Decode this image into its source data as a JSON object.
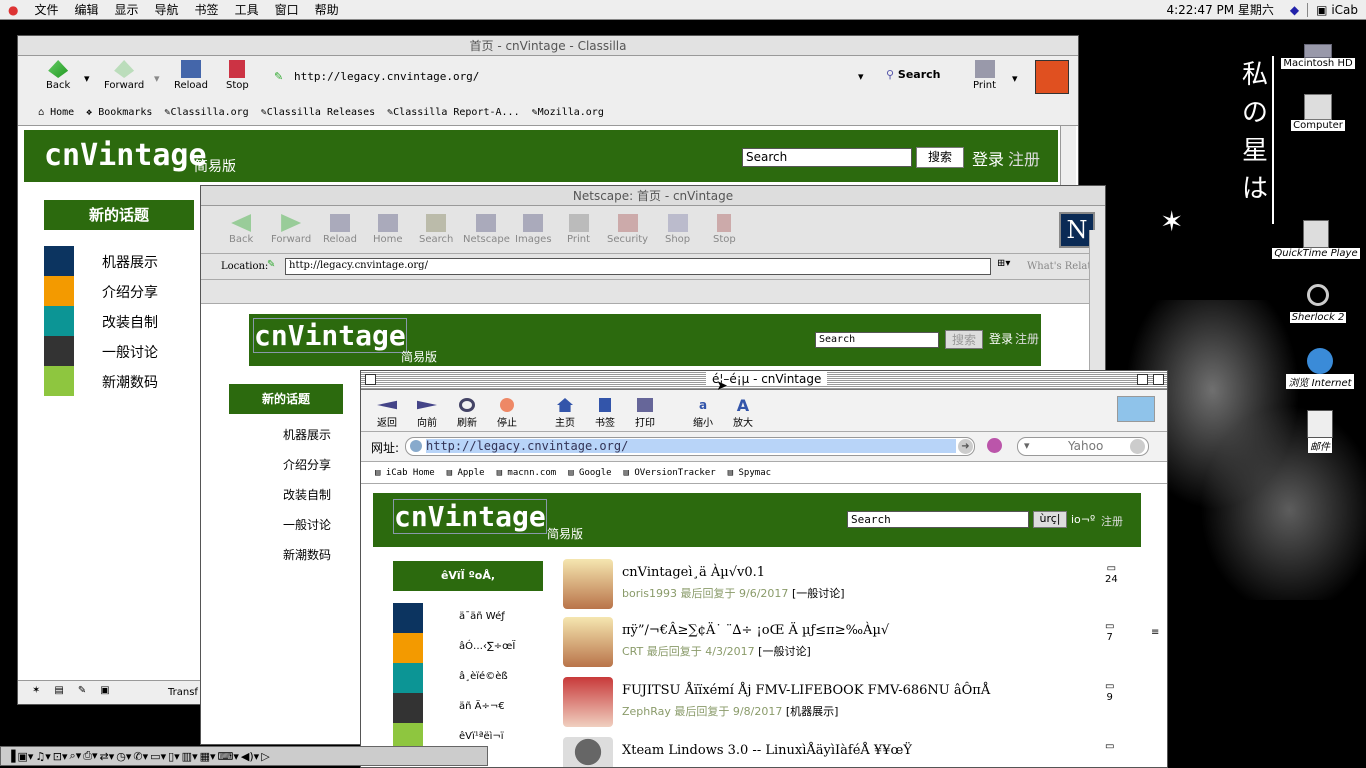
{
  "menubar": {
    "items": [
      "文件",
      "编辑",
      "显示",
      "导航",
      "书签",
      "工具",
      "窗口",
      "帮助"
    ],
    "clock": "4:22:47 PM 星期六",
    "app": "iCab"
  },
  "desktop": {
    "icons": [
      {
        "label": "Macintosh HD",
        "icon": "harddisk-icon"
      },
      {
        "label": "Computer",
        "icon": "computer-icon"
      },
      {
        "label": "QuickTime Playe",
        "icon": "quicktime-icon"
      },
      {
        "label": "Sherlock 2",
        "icon": "sherlock-icon"
      },
      {
        "label": "浏览 Internet",
        "icon": "browse-internet-icon"
      },
      {
        "label": "邮件",
        "icon": "mail-icon"
      }
    ],
    "poem": "私の星は"
  },
  "classilla": {
    "title": "首页 - cnVintage - Classilla",
    "toolbar": [
      "Back",
      "Forward",
      "Reload",
      "Stop"
    ],
    "url": "http://legacy.cnvintage.org/",
    "search": "Search",
    "print": "Print",
    "bookmarks": [
      "Home",
      "Bookmarks",
      "Classilla.org",
      "Classilla Releases",
      "Classilla Report-A...",
      "Mozilla.org"
    ],
    "status": "Transf",
    "site": {
      "logo": "cnVintage",
      "logo_sub": "简易版",
      "search_value": "Search",
      "search_btn": "搜索",
      "login": "登录",
      "register": "注册",
      "heading": "新的话题",
      "categories": [
        {
          "label": "机器展示",
          "color": "#0c3460"
        },
        {
          "label": "介绍分享",
          "color": "#f39a00"
        },
        {
          "label": "改装自制",
          "color": "#0c9595"
        },
        {
          "label": "一般讨论",
          "color": "#333333"
        },
        {
          "label": "新潮数码",
          "color": "#8ec63f"
        }
      ]
    }
  },
  "netscape": {
    "title": "Netscape: 首页 - cnVintage",
    "toolbar": [
      "Back",
      "Forward",
      "Reload",
      "Home",
      "Search",
      "Netscape",
      "Images",
      "Print",
      "Security",
      "Shop",
      "Stop"
    ],
    "location_label": "Location:",
    "url": "http://legacy.cnvintage.org/",
    "related": "What's Related",
    "site": {
      "logo": "cnVintage",
      "logo_sub": "简易版",
      "search_value": "Search",
      "search_btn": "搜索",
      "login": "登录",
      "register": "注册",
      "heading": "新的话题",
      "categories": [
        "机器展示",
        "介绍分享",
        "改装自制",
        "一般讨论",
        "新潮数码"
      ]
    }
  },
  "icab": {
    "title": "é¦–é¡µ - cnVintage",
    "toolbar": [
      "返回",
      "向前",
      "刷新",
      "停止",
      "主页",
      "书签",
      "打印",
      "缩小",
      "放大"
    ],
    "address_label": "网址:",
    "url": "http://legacy.cnvintage.org/",
    "search_engine": "Yahoo",
    "bookmarks": [
      "iCab Home",
      "Apple",
      "macnn.com",
      "Google",
      "OVersionTracker",
      "Spymac"
    ],
    "site": {
      "logo": "cnVintage",
      "logo_sub": "简易版",
      "search_value": "Search",
      "search_btn": "ùrç|",
      "login": "io¬º",
      "register": "注册",
      "heading": "êVïÏ ºoÅ,",
      "categories": [
        "ä¯äñ Wéƒ",
        "âÓ…‹∑÷œÏ",
        "â¸èïé©èß",
        "äñ   Ä÷¬€",
        "êVï¹ªëì¬ï"
      ],
      "topics": [
        {
          "title": "cnVintageì¸ä   Àµ√v0.1",
          "user": "boris1993",
          "meta": "最后回复于 9/6/2017",
          "forum": "[一般讨论]",
          "count": "24"
        },
        {
          "title": "πÿ”/¬€Â≥∑¢Ä˙ ¨∆÷ ¡oŒ Ä µƒ≤π≥‰Àµ√",
          "user": "CRT",
          "meta": "最后回复于 4/3/2017",
          "forum": "[一般讨论]",
          "count": "7"
        },
        {
          "title": "FUJITSU Åïïxémí Åj   FMV-LIFEBOOK FMV-686NU âÔπÅ",
          "user": "ZephRay",
          "meta": "最后回复于 9/8/2017",
          "forum": "[机器展示]",
          "count": "9"
        },
        {
          "title": "Xteam Lindows 3.0 -- LinuxìÅäyìIàféÅ   ¥¥œŸ",
          "user": "",
          "meta": "",
          "forum": "",
          "count": ""
        }
      ]
    }
  }
}
